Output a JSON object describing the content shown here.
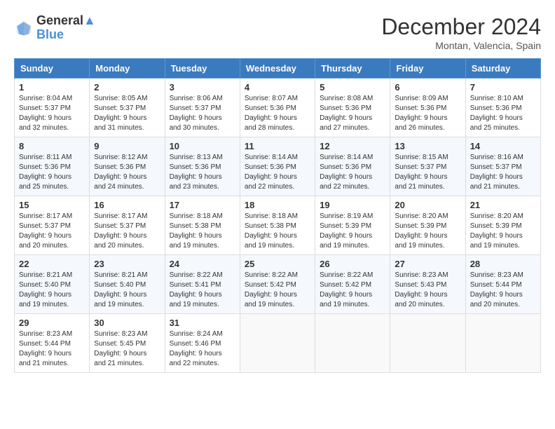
{
  "header": {
    "logo_line1": "General",
    "logo_line2": "Blue",
    "month_title": "December 2024",
    "location": "Montan, Valencia, Spain"
  },
  "days_of_week": [
    "Sunday",
    "Monday",
    "Tuesday",
    "Wednesday",
    "Thursday",
    "Friday",
    "Saturday"
  ],
  "weeks": [
    [
      {
        "day": "1",
        "sunrise": "8:04 AM",
        "sunset": "5:37 PM",
        "daylight": "9 hours and 32 minutes."
      },
      {
        "day": "2",
        "sunrise": "8:05 AM",
        "sunset": "5:37 PM",
        "daylight": "9 hours and 31 minutes."
      },
      {
        "day": "3",
        "sunrise": "8:06 AM",
        "sunset": "5:37 PM",
        "daylight": "9 hours and 30 minutes."
      },
      {
        "day": "4",
        "sunrise": "8:07 AM",
        "sunset": "5:36 PM",
        "daylight": "9 hours and 28 minutes."
      },
      {
        "day": "5",
        "sunrise": "8:08 AM",
        "sunset": "5:36 PM",
        "daylight": "9 hours and 27 minutes."
      },
      {
        "day": "6",
        "sunrise": "8:09 AM",
        "sunset": "5:36 PM",
        "daylight": "9 hours and 26 minutes."
      },
      {
        "day": "7",
        "sunrise": "8:10 AM",
        "sunset": "5:36 PM",
        "daylight": "9 hours and 25 minutes."
      }
    ],
    [
      {
        "day": "8",
        "sunrise": "8:11 AM",
        "sunset": "5:36 PM",
        "daylight": "9 hours and 25 minutes."
      },
      {
        "day": "9",
        "sunrise": "8:12 AM",
        "sunset": "5:36 PM",
        "daylight": "9 hours and 24 minutes."
      },
      {
        "day": "10",
        "sunrise": "8:13 AM",
        "sunset": "5:36 PM",
        "daylight": "9 hours and 23 minutes."
      },
      {
        "day": "11",
        "sunrise": "8:14 AM",
        "sunset": "5:36 PM",
        "daylight": "9 hours and 22 minutes."
      },
      {
        "day": "12",
        "sunrise": "8:14 AM",
        "sunset": "5:36 PM",
        "daylight": "9 hours and 22 minutes."
      },
      {
        "day": "13",
        "sunrise": "8:15 AM",
        "sunset": "5:37 PM",
        "daylight": "9 hours and 21 minutes."
      },
      {
        "day": "14",
        "sunrise": "8:16 AM",
        "sunset": "5:37 PM",
        "daylight": "9 hours and 21 minutes."
      }
    ],
    [
      {
        "day": "15",
        "sunrise": "8:17 AM",
        "sunset": "5:37 PM",
        "daylight": "9 hours and 20 minutes."
      },
      {
        "day": "16",
        "sunrise": "8:17 AM",
        "sunset": "5:37 PM",
        "daylight": "9 hours and 20 minutes."
      },
      {
        "day": "17",
        "sunrise": "8:18 AM",
        "sunset": "5:38 PM",
        "daylight": "9 hours and 19 minutes."
      },
      {
        "day": "18",
        "sunrise": "8:18 AM",
        "sunset": "5:38 PM",
        "daylight": "9 hours and 19 minutes."
      },
      {
        "day": "19",
        "sunrise": "8:19 AM",
        "sunset": "5:39 PM",
        "daylight": "9 hours and 19 minutes."
      },
      {
        "day": "20",
        "sunrise": "8:20 AM",
        "sunset": "5:39 PM",
        "daylight": "9 hours and 19 minutes."
      },
      {
        "day": "21",
        "sunrise": "8:20 AM",
        "sunset": "5:39 PM",
        "daylight": "9 hours and 19 minutes."
      }
    ],
    [
      {
        "day": "22",
        "sunrise": "8:21 AM",
        "sunset": "5:40 PM",
        "daylight": "9 hours and 19 minutes."
      },
      {
        "day": "23",
        "sunrise": "8:21 AM",
        "sunset": "5:40 PM",
        "daylight": "9 hours and 19 minutes."
      },
      {
        "day": "24",
        "sunrise": "8:22 AM",
        "sunset": "5:41 PM",
        "daylight": "9 hours and 19 minutes."
      },
      {
        "day": "25",
        "sunrise": "8:22 AM",
        "sunset": "5:42 PM",
        "daylight": "9 hours and 19 minutes."
      },
      {
        "day": "26",
        "sunrise": "8:22 AM",
        "sunset": "5:42 PM",
        "daylight": "9 hours and 19 minutes."
      },
      {
        "day": "27",
        "sunrise": "8:23 AM",
        "sunset": "5:43 PM",
        "daylight": "9 hours and 20 minutes."
      },
      {
        "day": "28",
        "sunrise": "8:23 AM",
        "sunset": "5:44 PM",
        "daylight": "9 hours and 20 minutes."
      }
    ],
    [
      {
        "day": "29",
        "sunrise": "8:23 AM",
        "sunset": "5:44 PM",
        "daylight": "9 hours and 21 minutes."
      },
      {
        "day": "30",
        "sunrise": "8:23 AM",
        "sunset": "5:45 PM",
        "daylight": "9 hours and 21 minutes."
      },
      {
        "day": "31",
        "sunrise": "8:24 AM",
        "sunset": "5:46 PM",
        "daylight": "9 hours and 22 minutes."
      },
      null,
      null,
      null,
      null
    ]
  ]
}
